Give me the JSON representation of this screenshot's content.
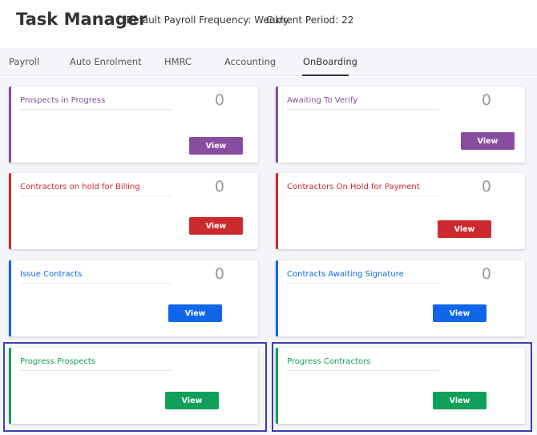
{
  "header": {
    "title": "Task Manager",
    "payroll_frequency": "Default Payroll Frequency: Weekly",
    "current_period": "Current Period: 22"
  },
  "tabs": [
    {
      "label": "Payroll"
    },
    {
      "label": "Auto Enrolment"
    },
    {
      "label": "HMRC"
    },
    {
      "label": "Accounting"
    },
    {
      "label": "OnBoarding",
      "active": true
    }
  ],
  "colors": {
    "purple": "#8a4d9e",
    "red": "#cc2a2f",
    "blue": "#0f66e9",
    "green": "#11a05a"
  },
  "cards": [
    {
      "title": "Prospects in Progress",
      "count": "0",
      "button": "View"
    },
    {
      "title": "Awaiting To Verify",
      "count": "0",
      "button": "View"
    },
    {
      "title": "Contractors on hold for Billing",
      "count": "0",
      "button": "View"
    },
    {
      "title": "Contractors On Hold for Payment",
      "count": "0",
      "button": "View"
    },
    {
      "title": "Issue Contracts",
      "count": "0",
      "button": "View"
    },
    {
      "title": "Contracts Awaiting Signature",
      "count": "0",
      "button": "View"
    },
    {
      "title": "Progress Prospects",
      "count": "",
      "button": "View"
    },
    {
      "title": "Progress Contractors",
      "count": "",
      "button": "View"
    }
  ]
}
